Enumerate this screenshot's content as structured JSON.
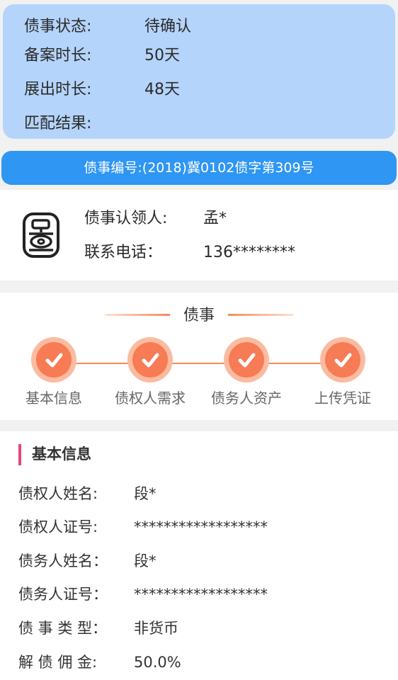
{
  "status": {
    "rows": [
      {
        "label": "债事状态:",
        "value": "待确认"
      },
      {
        "label": "备案时长:",
        "value": "50天"
      },
      {
        "label": "展出时长:",
        "value": "48天"
      },
      {
        "label": "匹配结果:",
        "value": ""
      }
    ]
  },
  "debt_number": "债事编号:(2018)冀0102债字第309号",
  "claimer": {
    "icon": "claimer-seal-icon",
    "name_label": "债事认领人:",
    "name_value": "孟*",
    "phone_label": "联系电话：",
    "phone_value": "136********"
  },
  "progress": {
    "title": "债事",
    "steps": [
      {
        "label": "基本信息",
        "done": true
      },
      {
        "label": "债权人需求",
        "done": true
      },
      {
        "label": "债务人资产",
        "done": true
      },
      {
        "label": "上传凭证",
        "done": true
      }
    ]
  },
  "basic_info": {
    "title": "基本信息",
    "rows": [
      {
        "label": "债权人姓名:",
        "value": "段*"
      },
      {
        "label": "债权人证号:",
        "value": "******************"
      },
      {
        "label": "债务人姓名：",
        "value": "段*"
      },
      {
        "label": "债务人证号：",
        "value": "******************"
      },
      {
        "label": "债 事 类 型：",
        "value": "非货币"
      },
      {
        "label": "解 债 佣 金:",
        "value": "50.0%"
      }
    ]
  },
  "colors": {
    "status_bg": "#b5d4fb",
    "number_bar": "#2f96f3",
    "accent_orange": "#f77b55",
    "section_marker": "#e8457b"
  }
}
